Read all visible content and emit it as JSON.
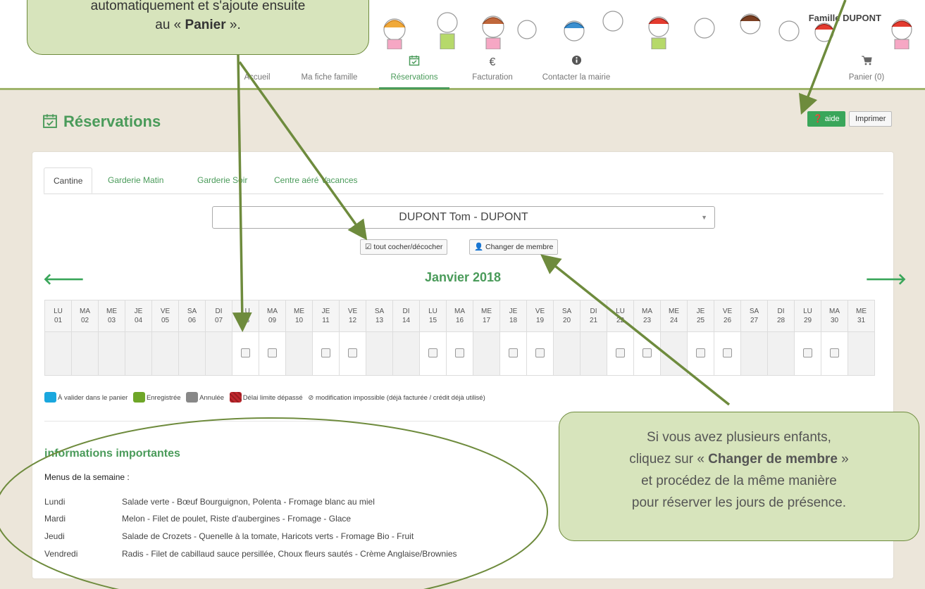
{
  "header": {
    "family_name": "Famille DUPONT"
  },
  "nav": [
    {
      "label": "Accueil",
      "icon": "home-icon"
    },
    {
      "label": "Ma fiche famille",
      "icon": "user-icon"
    },
    {
      "label": "Réservations",
      "icon": "calendar-check-icon"
    },
    {
      "label": "Facturation",
      "icon": "euro-icon"
    },
    {
      "label": "Contacter la mairie",
      "icon": "info-icon"
    }
  ],
  "cart": {
    "label": "Panier (0)",
    "icon": "cart-icon"
  },
  "page": {
    "title": "Réservations",
    "help_label": "aide",
    "print_label": "Imprimer"
  },
  "tabs": [
    "Cantine",
    "Garderie Matin",
    "Garderie Soir",
    "Centre aéré Vacances"
  ],
  "member_select": {
    "value": "DUPONT Tom - DUPONT"
  },
  "actions": {
    "toggle_all": "tout cocher/décocher",
    "change_member": "Changer de membre"
  },
  "calendar": {
    "month": "Janvier 2018",
    "days": [
      {
        "d": "LU",
        "n": "01",
        "c": false
      },
      {
        "d": "MA",
        "n": "02",
        "c": false
      },
      {
        "d": "ME",
        "n": "03",
        "c": false
      },
      {
        "d": "JE",
        "n": "04",
        "c": false
      },
      {
        "d": "VE",
        "n": "05",
        "c": false
      },
      {
        "d": "SA",
        "n": "06",
        "c": false
      },
      {
        "d": "DI",
        "n": "07",
        "c": false
      },
      {
        "d": "LU",
        "n": "08",
        "c": true
      },
      {
        "d": "MA",
        "n": "09",
        "c": true
      },
      {
        "d": "ME",
        "n": "10",
        "c": false
      },
      {
        "d": "JE",
        "n": "11",
        "c": true
      },
      {
        "d": "VE",
        "n": "12",
        "c": true
      },
      {
        "d": "SA",
        "n": "13",
        "c": false
      },
      {
        "d": "DI",
        "n": "14",
        "c": false
      },
      {
        "d": "LU",
        "n": "15",
        "c": true
      },
      {
        "d": "MA",
        "n": "16",
        "c": true
      },
      {
        "d": "ME",
        "n": "17",
        "c": false
      },
      {
        "d": "JE",
        "n": "18",
        "c": true
      },
      {
        "d": "VE",
        "n": "19",
        "c": true
      },
      {
        "d": "SA",
        "n": "20",
        "c": false
      },
      {
        "d": "DI",
        "n": "21",
        "c": false
      },
      {
        "d": "LU",
        "n": "22",
        "c": true
      },
      {
        "d": "MA",
        "n": "23",
        "c": true
      },
      {
        "d": "ME",
        "n": "24",
        "c": false
      },
      {
        "d": "JE",
        "n": "25",
        "c": true
      },
      {
        "d": "VE",
        "n": "26",
        "c": true
      },
      {
        "d": "SA",
        "n": "27",
        "c": false
      },
      {
        "d": "DI",
        "n": "28",
        "c": false
      },
      {
        "d": "LU",
        "n": "29",
        "c": true
      },
      {
        "d": "MA",
        "n": "30",
        "c": true
      },
      {
        "d": "ME",
        "n": "31",
        "c": false
      }
    ]
  },
  "legend": [
    {
      "label": "À valider dans le panier",
      "color": "#1aa7de"
    },
    {
      "label": "Enregistrée",
      "color": "#6ea628"
    },
    {
      "label": "Annulée",
      "color": "#888888"
    },
    {
      "label": "Délai limite dépassé",
      "color": "#c0282e"
    }
  ],
  "legend_note": "modification impossible (déjà facturée / crédit déjà utilisé)",
  "info": {
    "title": "informations importantes",
    "menus_title": "Menus de la semaine :",
    "menus": [
      {
        "day": "Lundi",
        "text": "Salade verte - Bœuf Bourguignon, Polenta - Fromage blanc au miel"
      },
      {
        "day": "Mardi",
        "text": "Melon - Filet de poulet, Riste d'aubergines - Fromage - Glace"
      },
      {
        "day": "Jeudi",
        "text": "Salade de Crozets - Quenelle à la tomate, Haricots verts - Fromage Bio - Fruit"
      },
      {
        "day": "Vendredi",
        "text": "Radis - Filet de cabillaud sauce persillée, Choux fleurs sautés - Crème Anglaise/Brownies"
      }
    ]
  },
  "annotations": {
    "callout1_line1": "automatiquement et s'ajoute ensuite",
    "callout1_pre": "au « ",
    "callout1_bold": "Panier",
    "callout1_post": " ».",
    "callout2_l1": "Si vous avez plusieurs enfants,",
    "callout2_pre": "cliquez sur « ",
    "callout2_bold": "Changer de membre",
    "callout2_post": " »",
    "callout2_l3": "et procédez de la même manière",
    "callout2_l4": "pour réserver les jours de présence."
  },
  "colors": {
    "accent": "#4a9b5a",
    "callout_bg": "#d7e4bc",
    "arrow": "#6e8b3d"
  }
}
